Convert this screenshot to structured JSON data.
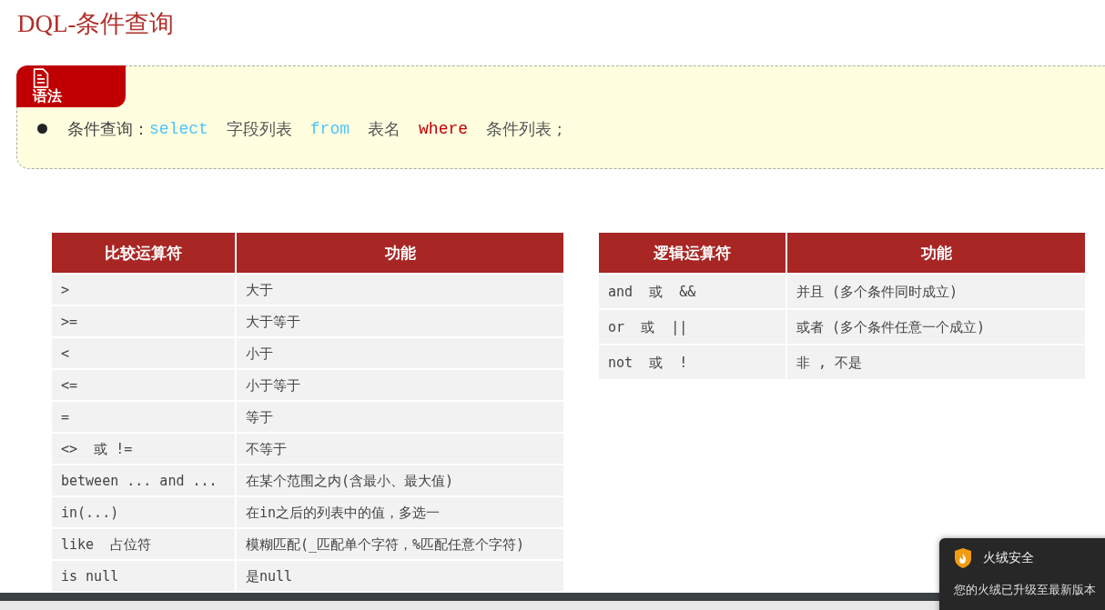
{
  "title": "DQL-条件查询",
  "syntax_box": {
    "tab_label": "语法",
    "items": [
      {
        "parts": [
          {
            "kind": "label",
            "text": "条件查询："
          },
          {
            "kind": "keyword",
            "text": "select"
          },
          {
            "kind": "text",
            "text": "字段列表"
          },
          {
            "kind": "keyword",
            "text": "from"
          },
          {
            "kind": "text",
            "text": "表名"
          },
          {
            "kind": "clause",
            "text": "where"
          },
          {
            "kind": "text",
            "text": "条件列表 ;"
          }
        ]
      }
    ]
  },
  "tables": [
    {
      "columns": [
        "比较运算符",
        "功能"
      ],
      "rows": [
        [
          ">",
          "大于"
        ],
        [
          ">=",
          "大于等于"
        ],
        [
          "<",
          "小于"
        ],
        [
          "<=",
          "小于等于"
        ],
        [
          "=",
          "等于"
        ],
        [
          "<>  或 !=",
          "不等于"
        ],
        [
          "between ... and ...",
          "在某个范围之内(含最小、最大值)"
        ],
        [
          "in(...)",
          "在in之后的列表中的值，多选一"
        ],
        [
          "like  占位符",
          "模糊匹配(_匹配单个字符，%匹配任意个字符)"
        ],
        [
          "is null",
          "是null"
        ]
      ]
    },
    {
      "columns": [
        "逻辑运算符",
        "功能"
      ],
      "rows": [
        [
          "and  或  &&",
          "并且 (多个条件同时成立)"
        ],
        [
          "or  或  ||",
          "或者 (多个条件任意一个成立)"
        ],
        [
          "not  或  !",
          "非 , 不是"
        ]
      ]
    }
  ],
  "notification": {
    "title": "火绒安全",
    "message": "您的火绒已升级至最新版本"
  }
}
